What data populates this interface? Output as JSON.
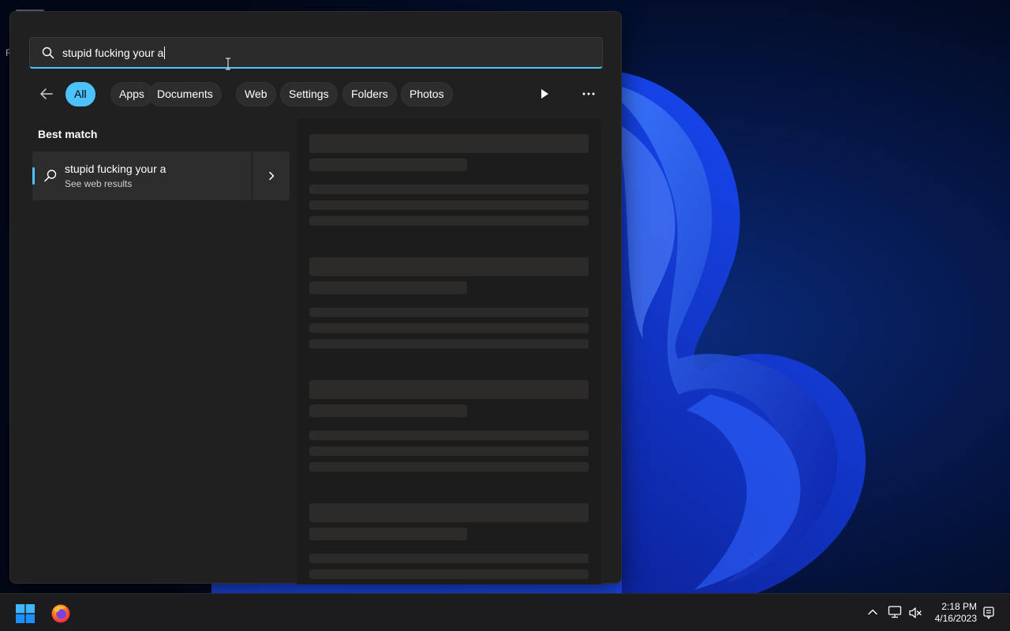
{
  "search": {
    "query": "stupid fucking your a"
  },
  "desktop": {
    "edge_letter": "R"
  },
  "filters": {
    "back_icon": "arrow-left-icon",
    "chips": [
      {
        "label": "All",
        "active": true
      },
      {
        "label": "Apps",
        "active": false
      },
      {
        "label": "Documents",
        "active": false
      },
      {
        "label": "Web",
        "active": false
      },
      {
        "label": "Settings",
        "active": false
      },
      {
        "label": "Folders",
        "active": false
      },
      {
        "label": "Photos",
        "active": false
      }
    ],
    "play_icon": "play-icon",
    "more_icon": "more-horizontal-icon"
  },
  "best_match": {
    "heading": "Best match",
    "title": "stupid fucking your a",
    "subtitle": "See web results",
    "icon": "search-icon"
  },
  "taskbar": {
    "time": "2:18 PM",
    "date": "4/16/2023",
    "apps": [
      "windows-start-icon",
      "firefox-icon"
    ],
    "tray": [
      "chevron-up-icon",
      "network-icon",
      "volume-muted-icon",
      "notification-icon"
    ]
  },
  "colors": {
    "accent": "#4cc2ff",
    "flyout_bg": "#202020",
    "taskbar_bg": "#1c1c1e"
  }
}
